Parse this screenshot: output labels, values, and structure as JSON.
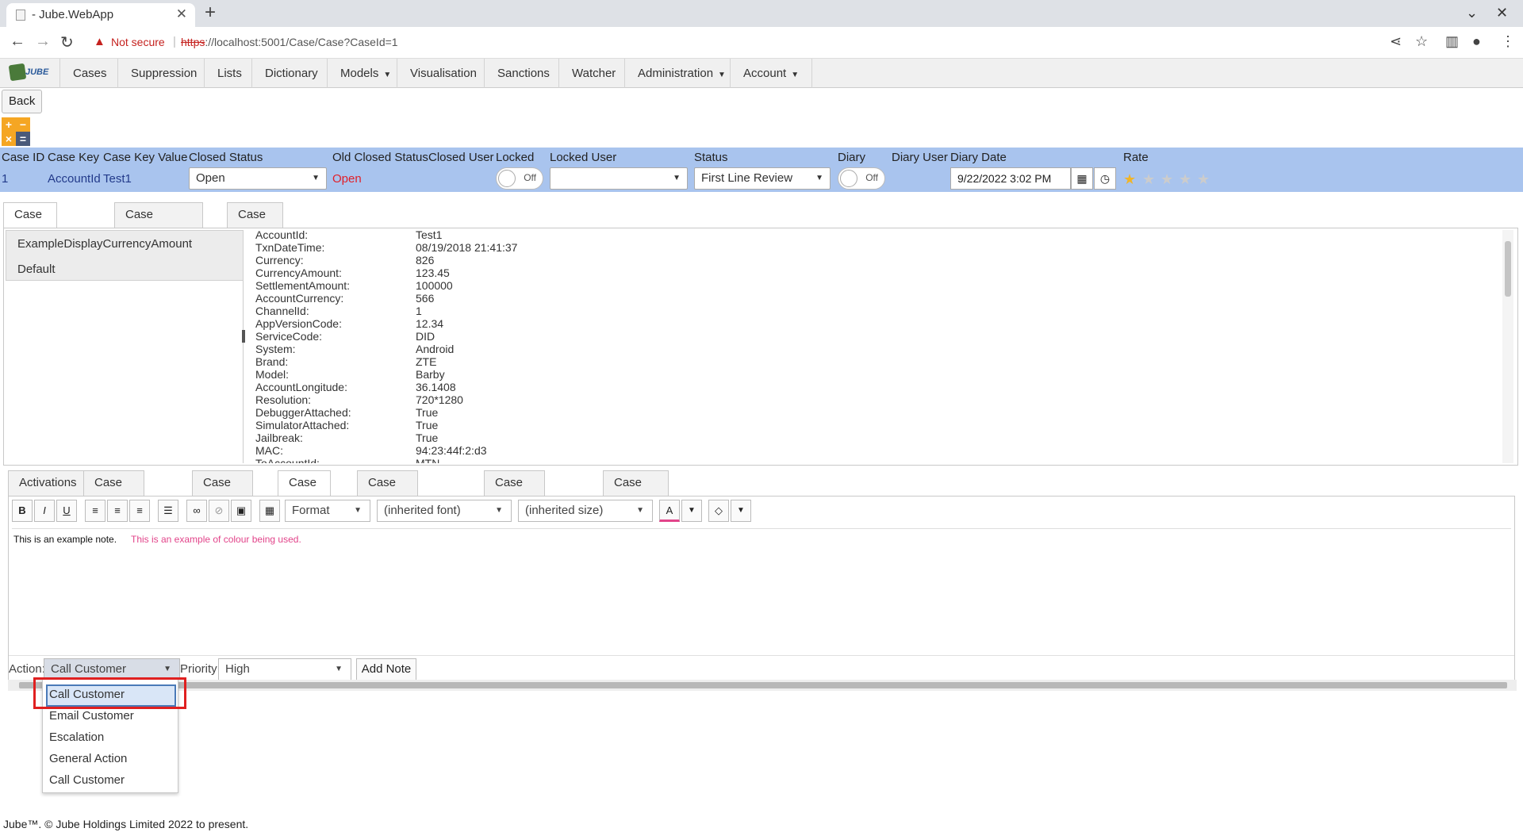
{
  "browser": {
    "tab_title": "- Jube.WebApp",
    "security_label": "Not secure",
    "url_scheme": "https",
    "url_rest": "://localhost:5001/Case/Case?CaseId=1"
  },
  "nav": {
    "logo_text": "JUBE",
    "items": [
      "Cases",
      "Suppression",
      "Lists",
      "Dictionary",
      "Models",
      "Visualisation",
      "Sanctions",
      "Watcher",
      "Administration",
      "Account"
    ]
  },
  "toolbar": {
    "back_label": "Back"
  },
  "case": {
    "headers": [
      "Case ID",
      "Case Key",
      "Case Key Value",
      "Closed Status",
      "Old Closed Status",
      "Closed User",
      "Locked",
      "Locked User",
      "Status",
      "Diary",
      "Diary User",
      "Diary Date",
      "Rate"
    ],
    "case_id": "1",
    "case_key": "AccountId",
    "case_key_value": "Test1",
    "closed_status": "Open",
    "old_closed_status": "Open",
    "locked_toggle": "Off",
    "locked_user": "",
    "status": "First Line Review",
    "diary_toggle": "Off",
    "diary_date": "9/22/2022 3:02 PM",
    "rating_stars": 0
  },
  "tabs_top": [
    "Case Detail Views",
    "Case Visualisation",
    "Case Forms"
  ],
  "views": [
    "ExampleDisplayCurrencyAmount",
    "Default"
  ],
  "details": [
    [
      "AccountId:",
      "Test1"
    ],
    [
      "TxnDateTime:",
      "08/19/2018 21:41:37"
    ],
    [
      "Currency:",
      "826"
    ],
    [
      "CurrencyAmount:",
      "123.45"
    ],
    [
      "SettlementAmount:",
      "100000"
    ],
    [
      "AccountCurrency:",
      "566"
    ],
    [
      "ChannelId:",
      "1"
    ],
    [
      "AppVersionCode:",
      "12.34"
    ],
    [
      "ServiceCode:",
      "DID"
    ],
    [
      "System:",
      "Android"
    ],
    [
      "Brand:",
      "ZTE"
    ],
    [
      "Model:",
      "Barby"
    ],
    [
      "AccountLongitude:",
      "36.1408"
    ],
    [
      "Resolution:",
      "720*1280"
    ],
    [
      "DebuggerAttached:",
      "True"
    ],
    [
      "SimulatorAttached:",
      "True"
    ],
    [
      "Jailbreak:",
      "True"
    ],
    [
      "MAC:",
      "94:23:44f:2:d3"
    ],
    [
      "ToAccountId:",
      "MTN"
    ]
  ],
  "tabs_bottom": [
    "Activations",
    "Case Key Journal",
    "Case Journal",
    "Case Notes",
    "Case Events Journal",
    "Case Forms Journal",
    "Case Uploads"
  ],
  "editor": {
    "format_label": "Format",
    "font_label": "(inherited font)",
    "size_label": "(inherited size)",
    "note_text": "This is an example note.",
    "note_coloured": "This is an example of colour being used.",
    "note_colour": "#e2448a"
  },
  "note_form": {
    "action_label": "Action:",
    "action_value": "Call Customer",
    "priority_label": "Priority:",
    "priority_value": "High",
    "add_button": "Add Note"
  },
  "action_options": [
    "Call Customer",
    "Email Customer",
    "Escalation",
    "General Action",
    "Call Customer"
  ],
  "footer": "Jube™. © Jube Holdings Limited 2022 to present."
}
